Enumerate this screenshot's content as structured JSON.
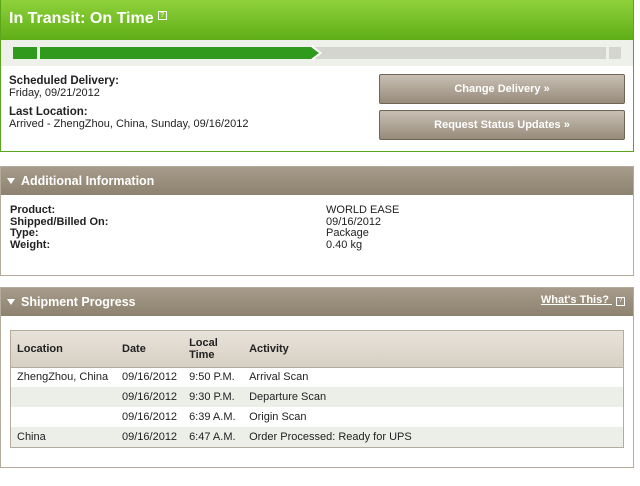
{
  "status": {
    "title": "In Transit: On Time",
    "help_mark": "?",
    "progress": 0.49,
    "colors": {
      "header": "#6cb925",
      "progress": "#2f9a1c",
      "button": "#a89d8d"
    }
  },
  "delivery": {
    "scheduled_label": "Scheduled Delivery:",
    "scheduled_value": "Friday, 09/21/2012",
    "last_location_label": "Last Location:",
    "last_location_value": "Arrived - ZhengZhou, China, Sunday, 09/16/2012"
  },
  "buttons": {
    "change_delivery": "Change Delivery »",
    "request_updates": "Request Status Updates »"
  },
  "additional": {
    "title": "Additional Information",
    "fields": [
      {
        "label": "Product:",
        "value": "WORLD EASE"
      },
      {
        "label": "Shipped/Billed On:",
        "value": "09/16/2012"
      },
      {
        "label": "Type:",
        "value": "Package"
      },
      {
        "label": "Weight:",
        "value": "0.40 kg"
      }
    ]
  },
  "shipment": {
    "title": "Shipment Progress",
    "whats_this": "What's This?",
    "help_mark": "?",
    "columns": [
      "Location",
      "Date",
      "Local Time",
      "Activity"
    ],
    "rows": [
      [
        "ZhengZhou, China",
        "09/16/2012",
        "9:50 P.M.",
        "Arrival Scan"
      ],
      [
        "",
        "09/16/2012",
        "9:30 P.M.",
        "Departure Scan"
      ],
      [
        "",
        "09/16/2012",
        "6:39 A.M.",
        "Origin Scan"
      ],
      [
        "China",
        "09/16/2012",
        "6:47 A.M.",
        "Order Processed: Ready for UPS"
      ]
    ]
  }
}
